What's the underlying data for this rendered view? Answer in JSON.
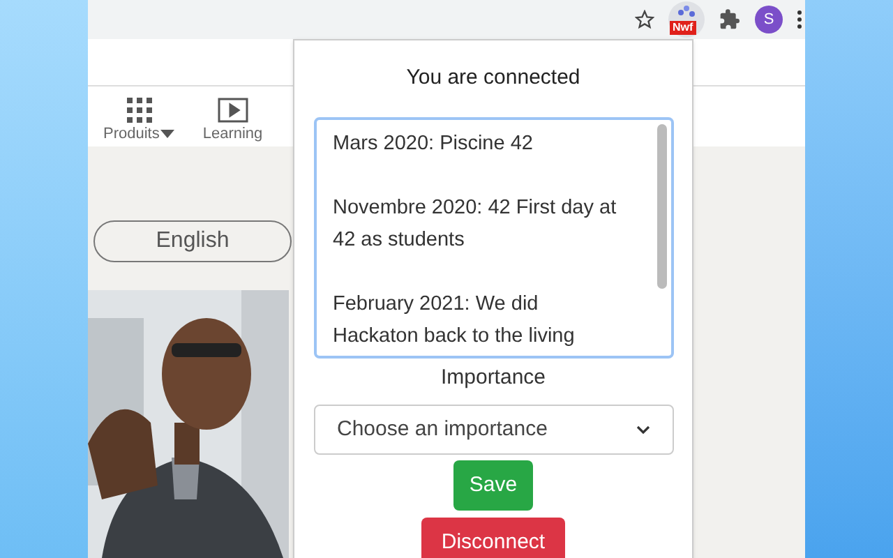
{
  "browser": {
    "extension_badge": "Nwf",
    "profile_initial": "S"
  },
  "page": {
    "nav_items": [
      {
        "label": "Produits"
      },
      {
        "label": "Learning"
      }
    ],
    "language_button": "English"
  },
  "popup": {
    "status": "You are connected",
    "notes": [
      "Mars 2020: Piscine 42",
      "Novembre 2020: 42 First day at 42 as students",
      "February 2021: We did Hackaton back to the living"
    ],
    "importance_label": "Importance",
    "importance_select": {
      "placeholder": "Choose an importance"
    },
    "save_button": "Save",
    "disconnect_button": "Disconnect"
  }
}
